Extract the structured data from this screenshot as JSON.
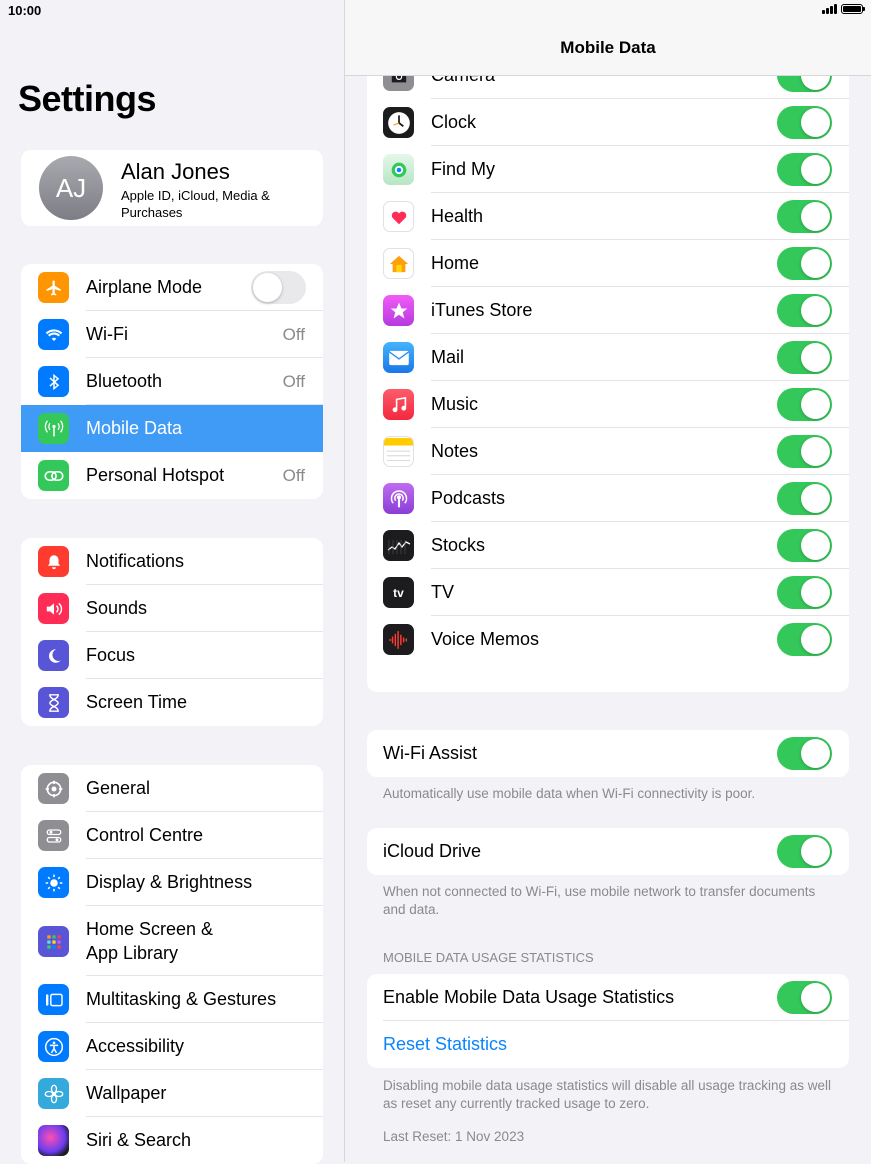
{
  "status": {
    "time": "10:00"
  },
  "sidebar": {
    "title": "Settings",
    "profile": {
      "initials": "AJ",
      "name": "Alan Jones",
      "subtitle": "Apple ID, iCloud, Media & Purchases"
    },
    "group1": [
      {
        "label": "Airplane Mode",
        "icon": "airplane-icon",
        "color": "#ff9500",
        "toggle": "off"
      },
      {
        "label": "Wi-Fi",
        "icon": "wifi-icon",
        "color": "#007aff",
        "value": "Off"
      },
      {
        "label": "Bluetooth",
        "icon": "bluetooth-icon",
        "color": "#007aff",
        "value": "Off"
      },
      {
        "label": "Mobile Data",
        "icon": "antenna-icon",
        "color": "#34c759",
        "selected": true
      },
      {
        "label": "Personal Hotspot",
        "icon": "hotspot-icon",
        "color": "#34c759",
        "value": "Off"
      }
    ],
    "group2": [
      {
        "label": "Notifications",
        "icon": "bell-icon",
        "color": "#ff3b30"
      },
      {
        "label": "Sounds",
        "icon": "speaker-icon",
        "color": "#ff2d55"
      },
      {
        "label": "Focus",
        "icon": "moon-icon",
        "color": "#5856d6"
      },
      {
        "label": "Screen Time",
        "icon": "hourglass-icon",
        "color": "#5856d6"
      }
    ],
    "group3": [
      {
        "label": "General",
        "icon": "gear-icon",
        "color": "#8e8e93"
      },
      {
        "label": "Control Centre",
        "icon": "switches-icon",
        "color": "#8e8e93"
      },
      {
        "label": "Display & Brightness",
        "icon": "sun-icon",
        "color": "#007aff"
      },
      {
        "label": "Home Screen &\nApp Library",
        "icon": "grid-icon",
        "color": "#5856d6"
      },
      {
        "label": "Multitasking & Gestures",
        "icon": "multitask-icon",
        "color": "#007aff"
      },
      {
        "label": "Accessibility",
        "icon": "accessibility-icon",
        "color": "#007aff"
      },
      {
        "label": "Wallpaper",
        "icon": "flower-icon",
        "color": "#34aadc"
      },
      {
        "label": "Siri & Search",
        "icon": "siri-icon",
        "color": "#1c1c1e"
      }
    ]
  },
  "main": {
    "nav_title": "Mobile Data",
    "apps": [
      {
        "label": "Camera",
        "icon": "camera-icon",
        "color": "#8e8e93",
        "on": true
      },
      {
        "label": "Clock",
        "icon": "clock-icon",
        "color": "#1c1c1e",
        "on": true
      },
      {
        "label": "Find My",
        "icon": "findmy-icon",
        "color": "#34c759",
        "on": true
      },
      {
        "label": "Health",
        "icon": "heart-icon",
        "color": "#ffffff",
        "on": true
      },
      {
        "label": "Home",
        "icon": "house-icon",
        "color": "#ffffff",
        "on": true
      },
      {
        "label": "iTunes Store",
        "icon": "star-icon",
        "color": "#d63cf0",
        "on": true
      },
      {
        "label": "Mail",
        "icon": "envelope-icon",
        "color": "#1e8cf5",
        "on": true
      },
      {
        "label": "Music",
        "icon": "music-note-icon",
        "color": "#fa3c4c",
        "on": true
      },
      {
        "label": "Notes",
        "icon": "notes-icon",
        "color": "#ffffff",
        "on": true
      },
      {
        "label": "Podcasts",
        "icon": "podcast-icon",
        "color": "#9b4dde",
        "on": true
      },
      {
        "label": "Stocks",
        "icon": "stocks-icon",
        "color": "#1c1c1e",
        "on": true
      },
      {
        "label": "TV",
        "icon": "tv-icon",
        "color": "#1c1c1e",
        "on": true,
        "icon_text": "tv"
      },
      {
        "label": "Voice Memos",
        "icon": "waveform-icon",
        "color": "#1c1c1e",
        "on": true
      }
    ],
    "wifi_assist": {
      "label": "Wi-Fi Assist",
      "on": true,
      "footer": "Automatically use mobile data when Wi-Fi connectivity is poor."
    },
    "icloud_drive": {
      "label": "iCloud Drive",
      "on": true,
      "footer": "When not connected to Wi-Fi, use mobile network to transfer documents and data."
    },
    "usage_header": "MOBILE DATA USAGE STATISTICS",
    "usage_toggle": {
      "label": "Enable Mobile Data Usage Statistics",
      "on": true
    },
    "reset_label": "Reset Statistics",
    "usage_footer": "Disabling mobile data usage statistics will disable all usage tracking as well as reset any currently tracked usage to zero.",
    "last_reset": "Last Reset: 1 Nov 2023"
  }
}
